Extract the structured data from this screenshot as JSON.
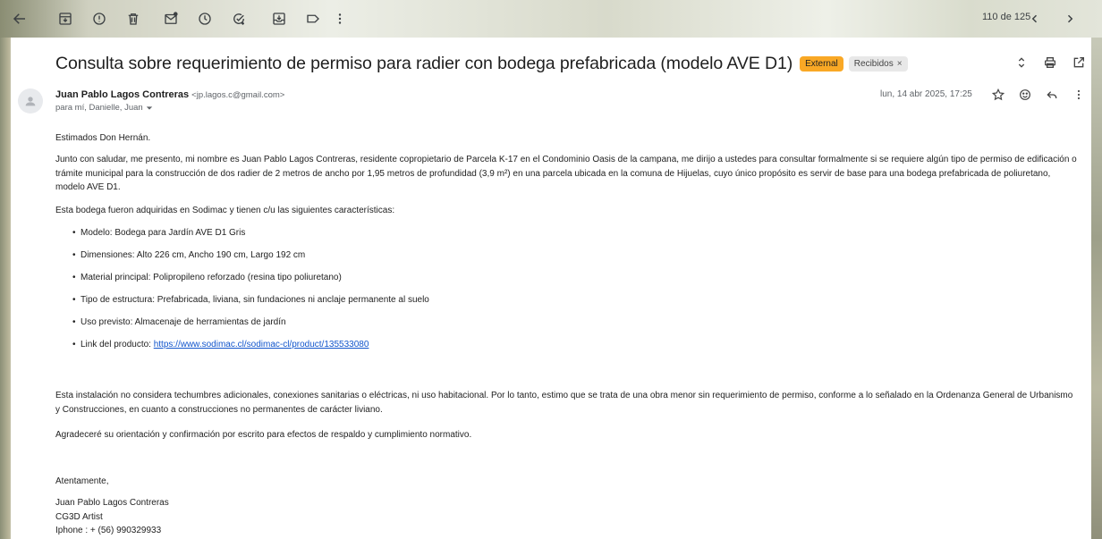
{
  "toolbar": {
    "back_icon": "arrow-left-icon",
    "icons": [
      "archive-icon",
      "report-spam-icon",
      "delete-icon",
      "mark-unread-icon",
      "snooze-icon",
      "add-task-icon",
      "move-to-icon",
      "label-icon",
      "more-vert-icon"
    ],
    "pager_text": "110 de 125"
  },
  "message": {
    "subject": "Consulta sobre requerimiento de permiso para radier con bodega prefabricada (modelo AVE D1)",
    "external_badge": "External",
    "inbox_label": "Recibidos",
    "inbox_close": "×",
    "sender_name": "Juan Pablo Lagos Contreras",
    "sender_email": "<jp.lagos.c@gmail.com>",
    "recipients": "para mí, Danielle, Juan",
    "date": "lun, 14 abr 2025, 17:25"
  },
  "body": {
    "greeting": "Estimados Don Hernán.",
    "intro": "Junto con saludar, me presento, mi nombre es Juan Pablo Lagos Contreras, residente copropietario de Parcela K-17 en el Condominio Oasis de la campana, me dirijo a ustedes para consultar formalmente si se requiere algún tipo de permiso de edificación o trámite municipal para la construcción de dos radier de 2 metros de ancho por 1,95 metros de profundidad (3,9 m²) en una parcela ubicada en la comuna de Hijuelas, cuyo único propósito es servir de base para una bodega prefabricada de poliuretano, modelo AVE D1.",
    "bodega": "Esta bodega fueron adquiridas en Sodimac y tienen c/u las siguientes características:",
    "features": [
      "Modelo: Bodega para Jardín AVE D1 Gris",
      "Dimensiones: Alto 226 cm, Ancho 190 cm, Largo 192 cm",
      "Material principal: Polipropileno reforzado (resina tipo poliuretano)",
      "Tipo de estructura: Prefabricada, liviana, sin fundaciones ni anclaje permanente al suelo",
      "Uso previsto: Almacenaje de herramientas de jardín"
    ],
    "link_label": "Link del producto: ",
    "link_url": "https://www.sodimac.cl/sodimac-cl/product/135533080",
    "note": "Esta instalación no considera techumbres adicionales, conexiones sanitarias o eléctricas, ni uso habitacional. Por lo tanto, estimo que se trata de una obra menor sin requerimiento de permiso, conforme a lo señalado en la Ordenanza General de Urbanismo y Construcciones, en cuanto a construcciones no permanentes de carácter liviano.",
    "thanks": "Agradeceré su orientación y confirmación por escrito para efectos de respaldo y cumplimiento normativo.",
    "regards": "Atentamente,",
    "signature": [
      "Juan Pablo Lagos Contreras",
      "CG3D Artist",
      "Iphone : + (56) 990329933"
    ]
  }
}
